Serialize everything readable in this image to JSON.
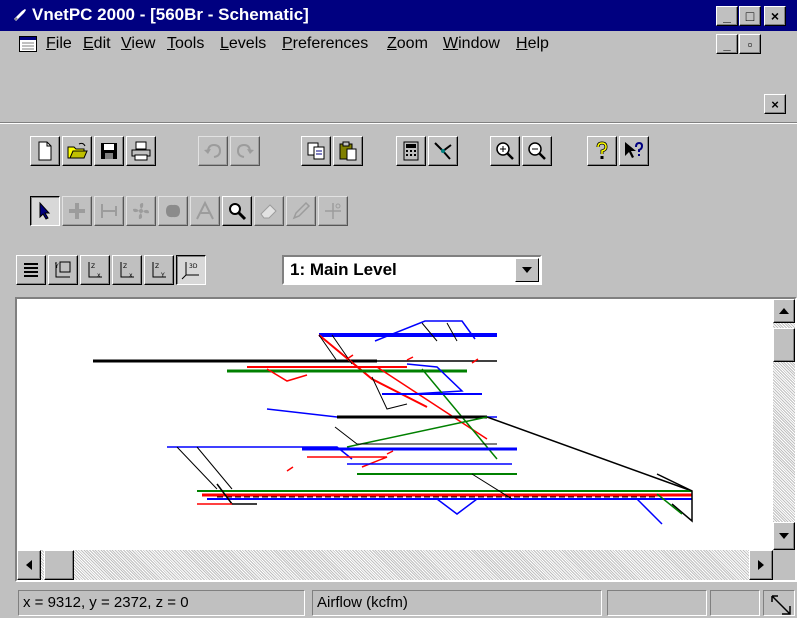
{
  "window": {
    "title": "VnetPC 2000 - [560Br - Schematic]",
    "buttons": {
      "minimize": "_",
      "maximize": "□",
      "close": "×"
    }
  },
  "menu": {
    "items": [
      {
        "key": "F",
        "rest": "ile"
      },
      {
        "key": "E",
        "rest": "dit"
      },
      {
        "key": "V",
        "rest": "iew"
      },
      {
        "key": "T",
        "rest": "ools"
      },
      {
        "key": "L",
        "rest": "evels"
      },
      {
        "key": "P",
        "rest": "references"
      },
      {
        "key": "Z",
        "rest": "oom"
      },
      {
        "key": "W",
        "rest": "indow"
      },
      {
        "key": "H",
        "rest": "elp"
      }
    ],
    "mdi_buttons": {
      "minimize": "_",
      "restore": "▫",
      "close": "×"
    }
  },
  "toolbar_standard": [
    {
      "icon": "new-document-icon",
      "enabled": true
    },
    {
      "icon": "open-folder-icon",
      "enabled": true
    },
    {
      "icon": "save-disk-icon",
      "enabled": true
    },
    {
      "icon": "print-icon",
      "enabled": true
    },
    {
      "icon": "undo-icon",
      "enabled": false
    },
    {
      "icon": "redo-icon",
      "enabled": false
    },
    {
      "icon": "copy-icon",
      "enabled": true
    },
    {
      "icon": "paste-icon",
      "enabled": true
    },
    {
      "icon": "calculator-icon",
      "enabled": true
    },
    {
      "icon": "network-icon",
      "enabled": true
    },
    {
      "icon": "zoom-in-icon",
      "enabled": true
    },
    {
      "icon": "zoom-out-icon",
      "enabled": true
    },
    {
      "icon": "help-icon",
      "enabled": true
    },
    {
      "icon": "context-help-icon",
      "enabled": true
    }
  ],
  "toolbar_drawing": [
    {
      "icon": "select-arrow-icon",
      "enabled": true,
      "pressed": true
    },
    {
      "icon": "junction-icon",
      "enabled": false
    },
    {
      "icon": "branch-icon",
      "enabled": false
    },
    {
      "icon": "fan-icon",
      "enabled": false
    },
    {
      "icon": "blob-icon",
      "enabled": false
    },
    {
      "icon": "text-icon",
      "enabled": false
    },
    {
      "icon": "magnify-icon",
      "enabled": true
    },
    {
      "icon": "eraser-icon",
      "enabled": false
    },
    {
      "icon": "edit-pencil-icon",
      "enabled": false
    },
    {
      "icon": "scissors-icon",
      "enabled": false
    }
  ],
  "toolbar_view": [
    {
      "icon": "layers-icon",
      "enabled": true
    },
    {
      "icon": "view-yx-icon",
      "enabled": true
    },
    {
      "icon": "view-zx-icon",
      "enabled": true
    },
    {
      "icon": "view-zx2-icon",
      "enabled": true
    },
    {
      "icon": "view-zy-icon",
      "enabled": true
    },
    {
      "icon": "view-3d-icon",
      "enabled": true,
      "pressed": true
    }
  ],
  "level_select": {
    "value": "1: Main Level"
  },
  "status": {
    "coords": "x = 9312, y = 2372, z = 0",
    "mode": "Airflow (kcfm)",
    "pane3": "",
    "pane4": "",
    "pane5": ""
  },
  "colors": {
    "title_bar": "#000080",
    "chrome": "#c0c0c0",
    "airway_red": "#ff0000",
    "airway_blue": "#0000ff",
    "airway_green": "#008000"
  }
}
